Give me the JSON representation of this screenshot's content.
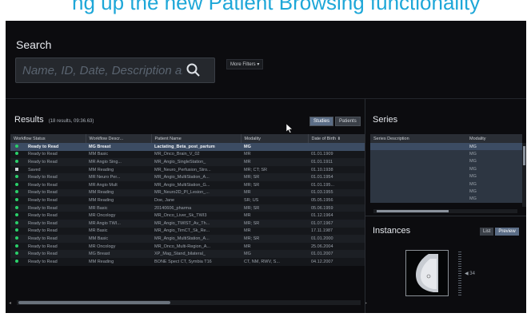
{
  "banner": {
    "text": "ng up the new Patient Browsing functionality"
  },
  "search": {
    "label": "Search",
    "placeholder": "Name, ID, Date, Description and",
    "more_filters": "More Filters ▾"
  },
  "results": {
    "title": "Results",
    "count": "(18 results, 09:36.63)",
    "toggle": [
      "Studies",
      "Patients"
    ],
    "columns": [
      "Workflow Status",
      "Workflow Descr...",
      "Patient Name",
      "Modality",
      "Date of Birth ⇟"
    ],
    "rows": [
      {
        "status": "Ready to Read",
        "descr": "MG Breast",
        "patient": "Lactating_Beta_post_partum",
        "modality": "MG",
        "dob": "",
        "icon": "dot",
        "selected": true
      },
      {
        "status": "Ready to Read",
        "descr": "MM Basic",
        "patient": "MR_Onco_Brain_V_02",
        "modality": "MR",
        "dob": "01.01.1909",
        "icon": "dot"
      },
      {
        "status": "Ready to Read",
        "descr": "MR Angio Sing...",
        "patient": "MR_Angio_SingleStation_",
        "modality": "MR",
        "dob": "01.01.1911",
        "icon": "dot"
      },
      {
        "status": "Saved",
        "descr": "MM Reading",
        "patient": "MR_Neuro_Perfusion_Stro...",
        "modality": "MR; CT; SR",
        "dob": "01.10.1938",
        "icon": "sq"
      },
      {
        "status": "Ready to Read",
        "descr": "MR Neuro Per...",
        "patient": "MR_Angio_MultiStation_A...",
        "modality": "MR; SR",
        "dob": "01.01.1954",
        "icon": "dot"
      },
      {
        "status": "Ready to Read",
        "descr": "MR Angio Mult",
        "patient": "MR_Angio_MultiStation_G...",
        "modality": "MR; SR",
        "dob": "01.01.195...",
        "icon": "dot"
      },
      {
        "status": "Ready to Read",
        "descr": "MM Reading",
        "patient": "MR_Neuro2D_PI_Lesion_...",
        "modality": "MR",
        "dob": "01.03.1955",
        "icon": "dot"
      },
      {
        "status": "Ready to Read",
        "descr": "MM Reading",
        "patient": "Doe, Jane",
        "modality": "SR; US",
        "dob": "05.05.1956",
        "icon": "dot"
      },
      {
        "status": "Ready to Read",
        "descr": "MR Basic",
        "patient": "20140606_pharma",
        "modality": "MR; SR",
        "dob": "05.06.1959",
        "icon": "dot"
      },
      {
        "status": "Ready to Read",
        "descr": "MR Oncology",
        "patient": "MR_Onco_Liver_Sk_TWI3",
        "modality": "MR",
        "dob": "01.12.1964",
        "icon": "dot"
      },
      {
        "status": "Ready to Read",
        "descr": "MR Angio TWI...",
        "patient": "MR_Angio_TWIST_Av_Th...",
        "modality": "MR; SR",
        "dob": "01.07.1967",
        "icon": "dot"
      },
      {
        "status": "Ready to Read",
        "descr": "MR Basic",
        "patient": "MR_Angio_TimCT_Sk_Re...",
        "modality": "MR",
        "dob": "17.11.1987",
        "icon": "dot"
      },
      {
        "status": "Ready to Read",
        "descr": "MM Basic",
        "patient": "MR_Angio_MultiStation_A...",
        "modality": "MR; SR",
        "dob": "01.01.2000",
        "icon": "dot"
      },
      {
        "status": "Ready to Read",
        "descr": "MR Oncology",
        "patient": "MR_Onco_Multi-Region_A...",
        "modality": "MR",
        "dob": "25.06.2004",
        "icon": "dot"
      },
      {
        "status": "Ready to Read",
        "descr": "MG Breast",
        "patient": "XP_Mag_Stand_bilateral_",
        "modality": "MG",
        "dob": "01.01.2007",
        "icon": "dot"
      },
      {
        "status": "Ready to Read",
        "descr": "MM Reading",
        "patient": "BONE Spect CT, Symbia T16",
        "modality": "CT, NM, RWV, S...",
        "dob": "04.12.2007",
        "icon": "dot"
      }
    ]
  },
  "series": {
    "title": "Series",
    "columns": [
      "Series Description",
      "Modality"
    ],
    "rows": [
      {
        "desc": "",
        "modality": "MG"
      },
      {
        "desc": "",
        "modality": "MG"
      },
      {
        "desc": "",
        "modality": "MG"
      },
      {
        "desc": "",
        "modality": "MG"
      },
      {
        "desc": "",
        "modality": "MG"
      },
      {
        "desc": "",
        "modality": "MG"
      },
      {
        "desc": "",
        "modality": "MG"
      },
      {
        "desc": "",
        "modality": "MG"
      }
    ]
  },
  "instances": {
    "title": "Instances",
    "toggle": [
      "List",
      "Preview"
    ],
    "slice_indicator": "◀ 34"
  },
  "colors": {
    "selected_row": "#3c4c63",
    "status_dot": "#2ad06a",
    "app_bg": "#0c0c0f",
    "banner_text": "#1ea7d8"
  }
}
